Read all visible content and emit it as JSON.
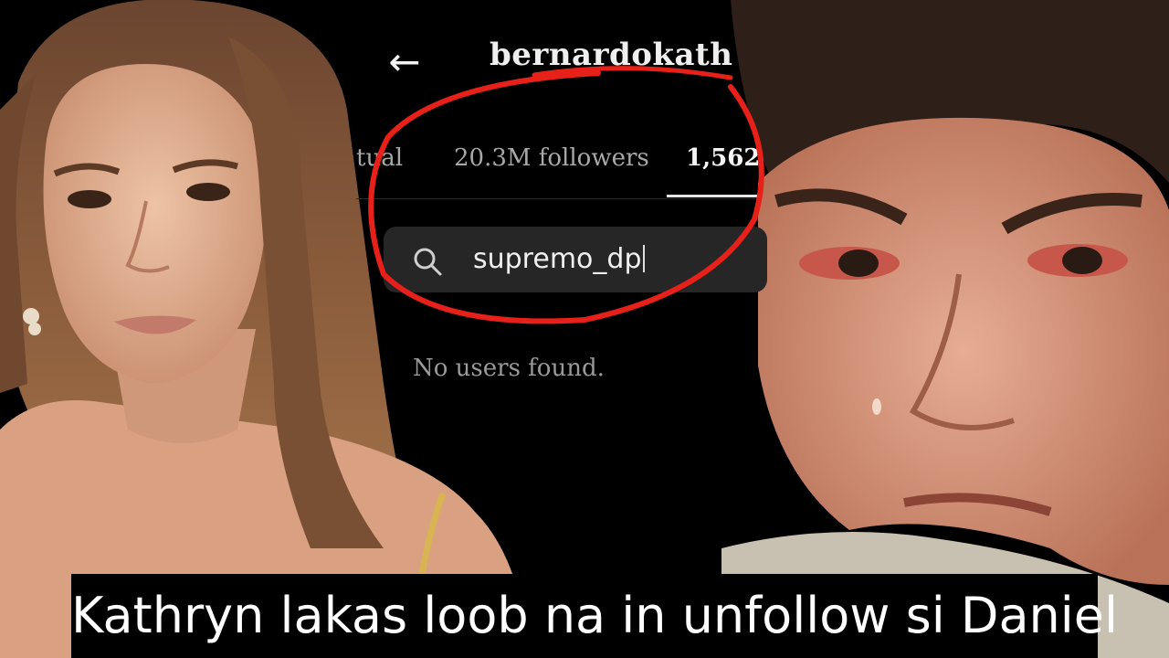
{
  "profile": {
    "back_icon": "arrow-left-icon",
    "username": "bernardokath"
  },
  "tabs": {
    "mutual": "tual",
    "followers": "20.3M followers",
    "following": "1,562"
  },
  "search": {
    "icon": "search-icon",
    "value": "supremo_dp"
  },
  "results": {
    "empty_message": "No users found."
  },
  "caption": {
    "text": "Kathryn lakas loob na in unfollow si Daniel"
  },
  "colors": {
    "background": "#000000",
    "annotation_red": "#e8201a",
    "search_field": "#262626",
    "caption_text": "#ffffff"
  }
}
